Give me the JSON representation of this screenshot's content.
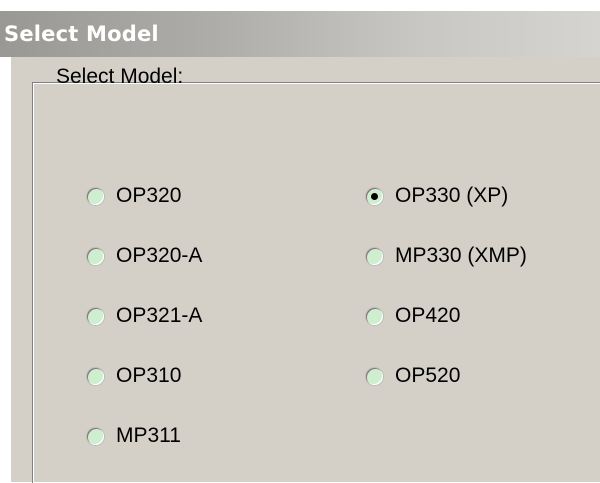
{
  "window": {
    "title": "Select Model"
  },
  "form": {
    "prompt": "Select Model:",
    "options": [
      {
        "label": "OP320",
        "selected": false
      },
      {
        "label": "OP320-A",
        "selected": false
      },
      {
        "label": "OP321-A",
        "selected": false
      },
      {
        "label": "OP310",
        "selected": false
      },
      {
        "label": "MP311",
        "selected": false
      },
      {
        "label": "OP330 (XP)",
        "selected": true
      },
      {
        "label": "MP330 (XMP)",
        "selected": false
      },
      {
        "label": "OP420",
        "selected": false
      },
      {
        "label": "OP520",
        "selected": false
      }
    ]
  },
  "colors": {
    "titlebar_start": "#9a9894",
    "titlebar_end": "#d6d4d0",
    "dialog_background": "#d4d0c8",
    "radio_fill": "#cfeecf"
  }
}
